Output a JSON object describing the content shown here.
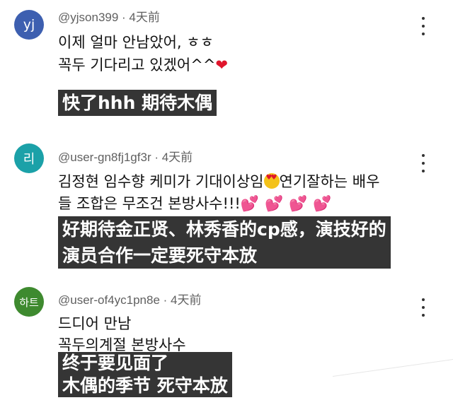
{
  "comments": [
    {
      "avatar_text": "yj",
      "avatar_color": "#3d5fb0",
      "author": "@yjson399",
      "time": "4天前",
      "lines": [
        "이제 얼마 안남았어, ㅎㅎ",
        "꼭두 기다리고 있겠어^^"
      ],
      "line2_emoji": "heart",
      "subtitle": [
        "快了hhh 期待木偶"
      ]
    },
    {
      "avatar_text": "리",
      "avatar_color": "#1ba1a8",
      "author": "@user-gn8fj1gf3r",
      "time": "4天前",
      "lines": [
        "김정현 임수향 케미가 기대이상임",
        "연기잘하는 배우",
        "들 조합은 무조건 본방사수!!!"
      ],
      "emojis": [
        "heart-eyes-emoji",
        "two-hearts-emoji"
      ],
      "subtitle": [
        "好期待金正贤、林秀香的cp感，演技好的",
        "演员合作一定要死守本放"
      ]
    },
    {
      "avatar_text": "하트",
      "avatar_color": "#3e8a2f",
      "author": "@user-of4yc1pn8e",
      "time": "4天前",
      "lines": [
        "드디어 만남",
        "꼭두의계절 본방사수"
      ],
      "subtitle": [
        "终于要见面了",
        "木偶的季节 死守本放"
      ]
    }
  ],
  "separator": " · ",
  "icons": {
    "more": "more-vertical-icon",
    "heart": "red-heart-icon"
  }
}
